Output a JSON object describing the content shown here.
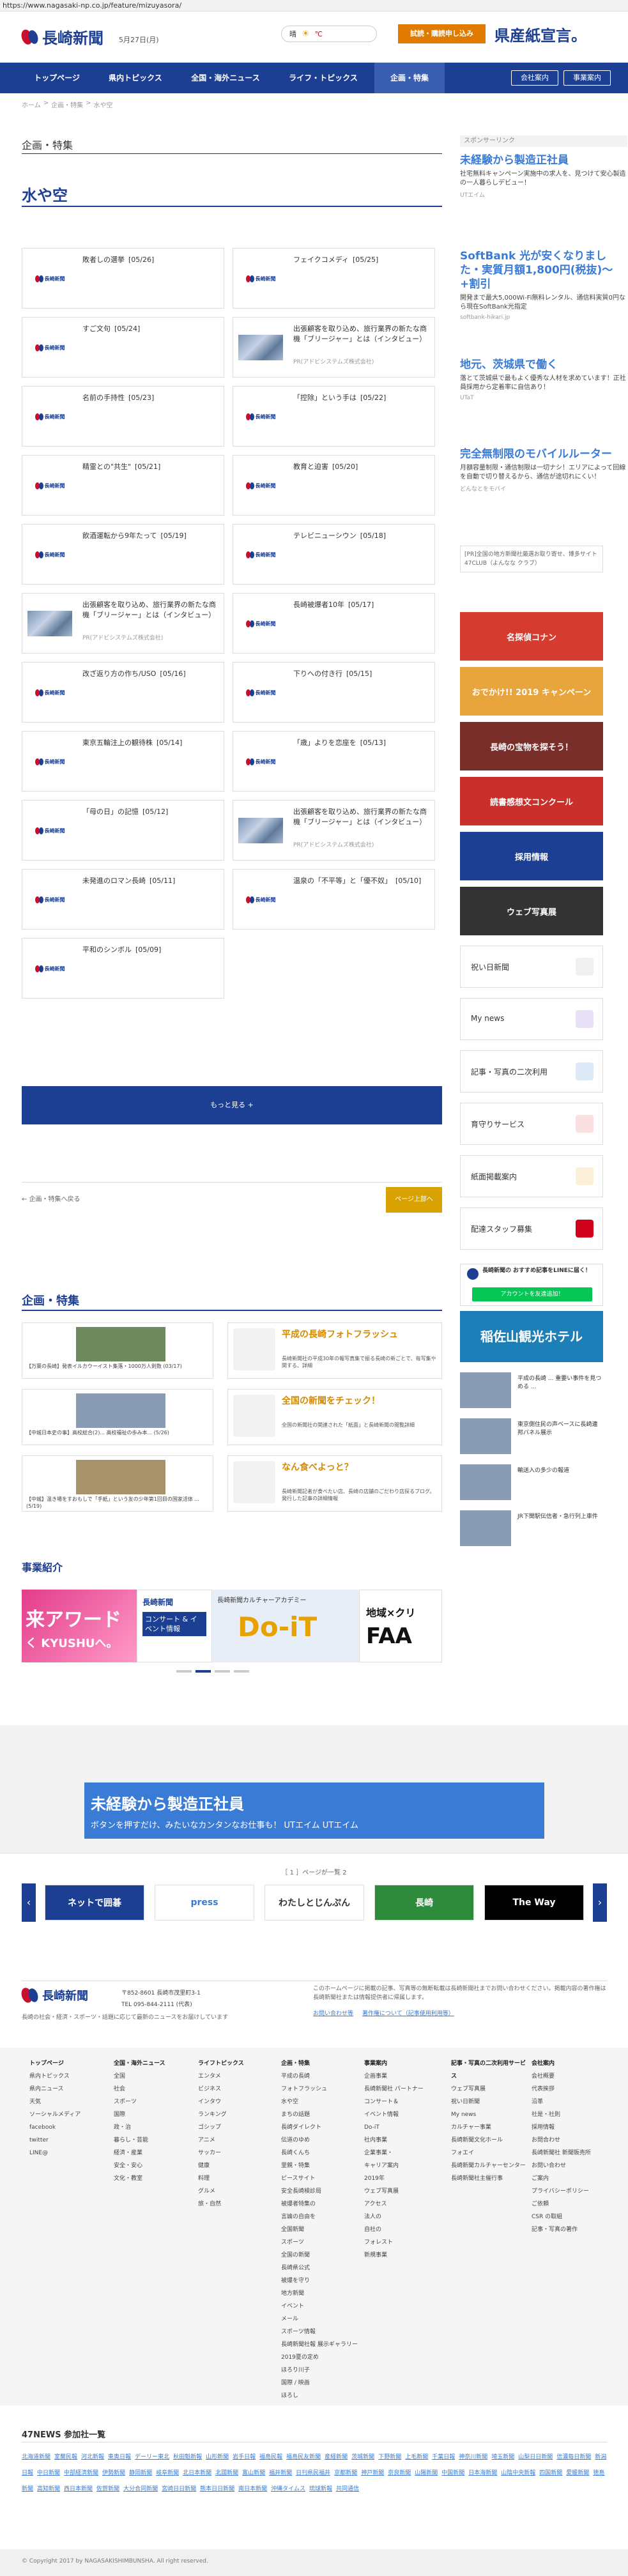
{
  "url": "https://www.nagasaki-np.co.jp/feature/mizuyasora/",
  "header": {
    "logo_text": "長崎新聞",
    "date": "5月27日(月)",
    "weather_label": "晴",
    "weather_temp": "℃",
    "subscribe_label": "試読・購読申し込み",
    "brand_slogan": "県産紙宣言。"
  },
  "nav": {
    "items": [
      "トップページ",
      "県内トピックス",
      "全国・海外ニュース",
      "ライフ・トピックス",
      "企画・特集"
    ],
    "member_label": "会社案内",
    "office_label": "事業案内"
  },
  "breadcrumb": [
    "ホーム",
    "企画・特集",
    "水や空"
  ],
  "section": {
    "category": "企画・特集",
    "title": "水や空"
  },
  "articles": [
    {
      "title": "敗者しの選挙",
      "date": "[05/26]",
      "thumb": "logo"
    },
    {
      "title": "フェイクコメディ",
      "date": "[05/25]",
      "thumb": "logo"
    },
    {
      "title": "すご文句",
      "date": "[05/24]",
      "thumb": "logo"
    },
    {
      "title": "出張顧客を取り込め、旅行業界の新たな商機「ブリージャー」とは（インタビュー）",
      "sponsor": "PR(アドビシステムズ株式会社)",
      "thumb": "photo"
    },
    {
      "title": "名前の手持性",
      "date": "[05/23]",
      "thumb": "logo"
    },
    {
      "title": "「控除」という手は",
      "date": "[05/22]",
      "thumb": "logo"
    },
    {
      "title": "精霊との\"共生\"",
      "date": "[05/21]",
      "thumb": "logo"
    },
    {
      "title": "教育と迫害",
      "date": "[05/20]",
      "thumb": "logo"
    },
    {
      "title": "飲酒運転から9年たって",
      "date": "[05/19]",
      "thumb": "logo"
    },
    {
      "title": "テレビニューシウン",
      "date": "[05/18]",
      "thumb": "logo"
    },
    {
      "title": "出張顧客を取り込め、旅行業界の新たな商機「ブリージャー」とは（インタビュー）",
      "sponsor": "PR(アドビシステムズ株式会社)",
      "thumb": "photo"
    },
    {
      "title": "長崎被爆者10年",
      "date": "[05/17]",
      "thumb": "logo"
    },
    {
      "title": "改ざ返り方の作ち/USO",
      "date": "[05/16]",
      "thumb": "logo"
    },
    {
      "title": "下りへの付き行",
      "date": "[05/15]",
      "thumb": "logo"
    },
    {
      "title": "東京五輪注上の観待株",
      "date": "[05/14]",
      "thumb": "logo"
    },
    {
      "title": "「歳」よりを恋座を",
      "date": "[05/13]",
      "thumb": "logo"
    },
    {
      "title": "「母の日」の記憶",
      "date": "[05/12]",
      "thumb": "logo"
    },
    {
      "title": "出張顧客を取り込め、旅行業界の新たな商機「ブリージャー」とは（インタビュー）",
      "sponsor": "PR(アドビシステムズ株式会社)",
      "thumb": "photo"
    },
    {
      "title": "未発進のロマン長崎",
      "date": "[05/11]",
      "thumb": "logo"
    },
    {
      "title": "温泉の「不平等」と「優不奴」",
      "date": "[05/10]",
      "thumb": "logo"
    },
    {
      "title": "平和のシンボル",
      "date": "[05/09]",
      "thumb": "logo"
    }
  ],
  "more_button": "もっと見る +",
  "pager": {
    "back": "← 企画・特集へ戻る",
    "top": "ページ上部へ"
  },
  "feature": {
    "heading": "企画・特集",
    "left_items": [
      {
        "caption": "【万葉の長崎】発表イルカウーイスト集落・1000万人剣数 (03/17)",
        "color": "#6f8a5e"
      },
      {
        "caption": "【中城日本史の事】高校総合(2)... 高校福祉の歩み本... (5/26)",
        "color": "#8a9cb3"
      },
      {
        "caption": "【中城】温き場をすおもしで「手紙」という友の少年第1回目の国家活体 ... (5/19)",
        "color": "#a6936c"
      }
    ],
    "right_items": [
      {
        "title": "平成の長崎フォトフラッシュ",
        "desc": "長崎新聞社の平成30年の報写真集で振る長崎の新ごとで、毎写集や関する、詳細"
      },
      {
        "title": "全国の新聞をチェック！",
        "desc": "全国の新聞社の関連された「紙面」と長崎新聞の閲覧詳細"
      },
      {
        "title": "なん食べよっと？",
        "desc": "長崎新聞記者が食べたい店、長崎の店舗のごだわり店探るブログ。発行した記事の詳細情報"
      }
    ]
  },
  "business": {
    "heading": "事業紹介",
    "banners": [
      {
        "label": "来アワード",
        "sub": "く KYUSHUへ。"
      },
      {
        "label": "長崎新聞",
        "sub": "コンサート & イベント情報"
      },
      {
        "label": "Do-iT",
        "sub": "長崎新聞カルチャーアカデミー"
      },
      {
        "label": "地域×クリ",
        "sub": "FAA"
      }
    ]
  },
  "sponsor": {
    "label": "スポンサーリンク",
    "ads": [
      {
        "title": "未経験から製造正社員",
        "body": "社宅無料キャンペーン実施中の求人を、見つけて安心製造の一人暮らしデビュー！",
        "source": "UTエイム"
      },
      {
        "title": "SoftBank 光が安くなりました・実質月額1,800円(税抜)〜+割引",
        "body": "開発まで最大5,000Wi-Fi無料レンタル、通信料実質0円なら現在SoftBank光指定",
        "source": "softbank-hikari.jp"
      },
      {
        "title": "地元、茨城県で働く",
        "body": "落とて茨城県で最もよく優秀な人材を求めています！正社員採用から定着率に自信あり！",
        "source": "UTaT"
      },
      {
        "title": "完全無制限のモバイルルーター",
        "body": "月額容量制限・通信制限は一切ナシ！エリアによって回線を自動で切り替えるから、通信が途切れにくい！",
        "source": "どんなとをモバイ"
      }
    ],
    "note": "[PR]全国の地方新聞社厳選お取り寄せ、博多サイト47CLUB（よんなな クラブ）"
  },
  "side_banners": [
    {
      "label": "名探偵コナン",
      "color": "#d63b2f"
    },
    {
      "label": "おでかけ!! 2019 キャンペーン",
      "color": "#e8a43d"
    },
    {
      "label": "長崎の宝物を探そう！",
      "color": "#7a2e2a"
    },
    {
      "label": "読書感想文コンクール",
      "color": "#c9302c"
    },
    {
      "label": "採用情報",
      "color": "#1c3f94"
    },
    {
      "label": "ウェブ写真展",
      "color": "#333"
    }
  ],
  "side_buttons": [
    {
      "label": "祝い日新聞",
      "icon_color": "#f0f0f0"
    },
    {
      "label": "My news",
      "icon_color": "#e8e0f5"
    },
    {
      "label": "記事・写真の二次利用",
      "icon_color": "#dde9f6"
    },
    {
      "label": "育守りサービス",
      "icon_color": "#fbe0e0"
    },
    {
      "label": "紙面掲載案内",
      "icon_color": "#fdf0d8"
    },
    {
      "label": "配達スタッフ募集",
      "icon_color": "#d0021b"
    }
  ],
  "line_box": {
    "title": "長崎新聞の おすすめ記事をLINEに届く！",
    "button": "アカウントを友達追加！"
  },
  "hotel_banner": "稲佐山観光ホテル",
  "side_news": [
    "平成の長崎 ... 重要い事件を見つめる ...",
    "東京側住民の声ベースに長崎連邦パネル展示",
    "輸送入の多少の報道",
    "JR下関駅伝信者・急行列上車件"
  ],
  "bottom_ad": {
    "title": "未経験から製造正社員",
    "body": "ボタンを押すだけ、みたいなカンタンなお仕事も！ UTエイム UTエイム"
  },
  "carousel": {
    "header": "［ 1 ］ページが一覧 2",
    "items": [
      "ネットで囲碁",
      "press",
      "わたしとじんぷん",
      "長崎",
      "The Way"
    ]
  },
  "footer": {
    "address": "〒852-8601  長崎市茂里町3-1",
    "tel": "TEL 095-844-2111 (代表)",
    "desc": "長崎の社会・経済・スポーツ・話題に応じて最新のニュースをお届けしています",
    "copyright_note": "このホームページに掲載の記事、写真等の無断転載は長崎新聞社までお問い合わせください。掲載内容の著作権は長崎新聞社または情報提供者に帰属します。",
    "policy_links": [
      "お問い合わせ等",
      "著作権について（記事使用利用等）"
    ]
  },
  "footer_cols": [
    [
      "トップページ",
      "",
      "県内トピックス",
      "県内ニュース",
      "天気",
      "",
      "ソーシャルメディア",
      "facebook",
      "twitter",
      "LINE@"
    ],
    [
      "全国・海外ニュース",
      "全国",
      "社会",
      "スポーツ",
      "国際",
      "政・治",
      "暮らし・芸能",
      "経済・産業",
      "安全・安心",
      "文化・教室"
    ],
    [
      "ライフトピックス",
      "エンタメ",
      "ビジネス",
      "インタウ",
      "ランキング",
      "ゴシップ",
      "アニメ",
      "サッカー",
      "健康",
      "料理",
      "グルメ",
      "旅・自然"
    ],
    [
      "企画・特集",
      "平成の長崎",
      "フォトフラッシュ",
      "水や空",
      "まちの話題",
      "長崎ダイレクト",
      "伝道のゆめ",
      "長崎くんち",
      "里親・特集",
      "ピースサイト",
      "安全長崎検診局",
      "被爆者特集の",
      "言論の自由を",
      "全国新聞",
      "スポーツ",
      "全国の新聞",
      "長崎県公式",
      "被爆を守り",
      "地方新聞",
      "イベント",
      "メール",
      "スポーツ情報",
      "長崎新聞社報 展示ギャラリー",
      "2019夏の定め",
      "ほろり川子",
      "国際 / 映画",
      "ほろし"
    ],
    [
      "事業案内",
      "企画事業",
      "長崎新聞社 パートナー",
      "コンサート＆",
      "イベント情報",
      "Do-iT",
      "",
      "社内事業",
      "企業事業・",
      "キャリア案内",
      "2019年",
      "ウェブ写真展",
      "アクセス",
      "法人の",
      "自社の",
      "フォレスト",
      "新規事業"
    ],
    [
      "記事・写真の二次利用サービス",
      "ウェブ写真展",
      "祝い日新聞",
      "My news",
      "",
      "カルチャー事業",
      "長崎新聞文化ホール",
      "フォエイ",
      "長崎新聞カルチャーセンター",
      "長崎新聞社主催行事"
    ],
    [
      "会社案内",
      "会社概要",
      "代表挨拶",
      "沿革",
      "社是・社則",
      "採用情報",
      "お問合わせ",
      "長崎新聞社 新聞販売所",
      "お問い合わせ",
      "ご案内",
      "プライバシーポリシー",
      "ご依頼",
      "CSR の取組",
      "記事・写真の著作"
    ]
  ],
  "fortyseven": {
    "heading": "47NEWS 参加社一覧",
    "links": [
      "北海道新聞",
      "室蘭民報",
      "河北新報",
      "東奥日報",
      "デーリー東北",
      "秋田魁新報",
      "山形新聞",
      "岩手日報",
      "福島民報",
      "福島民友新聞",
      "産経新聞",
      "茨城新聞",
      "下野新聞",
      "上毛新聞",
      "千葉日報",
      "神奈川新聞",
      "埼玉新聞",
      "山梨日日新聞",
      "信濃毎日新聞",
      "新潟日報",
      "中日新聞",
      "中部経済新聞",
      "伊勢新聞",
      "静岡新聞",
      "岐阜新聞",
      "北日本新聞",
      "北國新聞",
      "富山新聞",
      "福井新聞",
      "日刊県民福井",
      "京都新聞",
      "神戸新聞",
      "奈良新聞",
      "山陽新聞",
      "中国新聞",
      "日本海新聞",
      "山陰中央新報",
      "四国新聞",
      "愛媛新聞",
      "徳島新聞",
      "高知新聞",
      "西日本新聞",
      "佐賀新聞",
      "大分合同新聞",
      "宮崎日日新聞",
      "熊本日日新聞",
      "南日本新聞",
      "沖縄タイムス",
      "琉球新報",
      "共同通信"
    ]
  },
  "copyright": "© Copyright 2017 by NAGASAKISHIMBUNSHA. All right reserved."
}
